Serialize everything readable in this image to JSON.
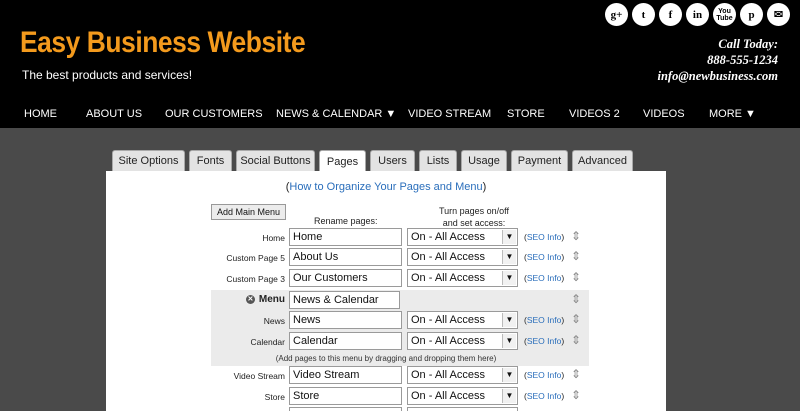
{
  "site": {
    "title": "Easy Business Website",
    "tagline": "The best products and services!",
    "call_label": "Call Today:",
    "phone": "888-555-1234",
    "email": "info@newbusiness.com",
    "social": [
      "g+",
      "t",
      "f",
      "in",
      "You Tube",
      "p",
      "✉"
    ]
  },
  "nav": [
    "HOME",
    "ABOUT US",
    "OUR CUSTOMERS",
    "NEWS & CALENDAR ▼",
    "VIDEO STREAM",
    "STORE",
    "VIDEOS 2",
    "VIDEOS",
    "MORE ▼"
  ],
  "tabs": [
    "Site Options",
    "Fonts",
    "Social Buttons",
    "Pages",
    "Users",
    "Lists",
    "Usage",
    "Payment",
    "Advanced"
  ],
  "active_tab": "Pages",
  "panel": {
    "help_open": "(",
    "help_link": "How to Organize Your Pages and Menu",
    "help_close": ")",
    "add_main_menu": "Add Main Menu",
    "rename_header": "Rename pages:",
    "access_header_1": "Turn pages on/off",
    "access_header_2": "and set access:",
    "seo_open": "(",
    "seo_link": "SEO Info",
    "seo_close": ")",
    "drag_hint": "(Add pages to this menu by dragging and dropping them here)",
    "menu_label": "Menu",
    "rows": [
      {
        "label": "Home",
        "value": "Home",
        "access": "On - All Access"
      },
      {
        "label": "Custom Page 5",
        "value": "About Us",
        "access": "On - All Access"
      },
      {
        "label": "Custom Page 3",
        "value": "Our Customers",
        "access": "On - All Access"
      },
      {
        "label": "Menu",
        "value": "News & Calendar"
      },
      {
        "label": "News",
        "value": "News",
        "access": "On - All Access"
      },
      {
        "label": "Calendar",
        "value": "Calendar",
        "access": "On - All Access"
      },
      {
        "label": "Video Stream",
        "value": "Video Stream",
        "access": "On - All Access"
      },
      {
        "label": "Store",
        "value": "Store",
        "access": "On - All Access"
      }
    ]
  }
}
